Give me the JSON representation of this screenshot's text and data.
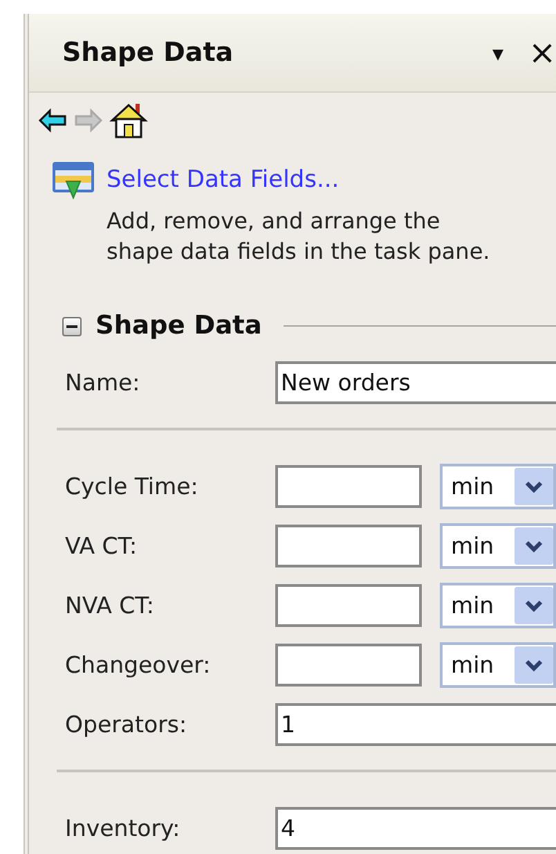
{
  "pane": {
    "title": "Shape Data",
    "menu_glyph": "▾",
    "close_glyph": "×"
  },
  "nav": {
    "back_enabled": true,
    "forward_enabled": false
  },
  "link": {
    "label": "Select Data Fields...",
    "description": "Add, remove, and arrange the shape data fields in the task pane."
  },
  "section": {
    "title": "Shape Data",
    "expanded": true,
    "groups": [
      [
        {
          "kind": "text",
          "label": "Name:",
          "value": "New orders"
        }
      ],
      [
        {
          "kind": "unit",
          "label": "Cycle Time:",
          "unit": "min"
        },
        {
          "kind": "unit",
          "label": "VA CT:",
          "unit": "min"
        },
        {
          "kind": "unit",
          "label": "NVA CT:",
          "unit": "min"
        },
        {
          "kind": "unit",
          "label": "Changeover:",
          "unit": "min"
        },
        {
          "kind": "text",
          "label": "Operators:",
          "value": "1"
        }
      ],
      [
        {
          "kind": "text",
          "label": "Inventory:",
          "value": "4"
        }
      ]
    ]
  }
}
